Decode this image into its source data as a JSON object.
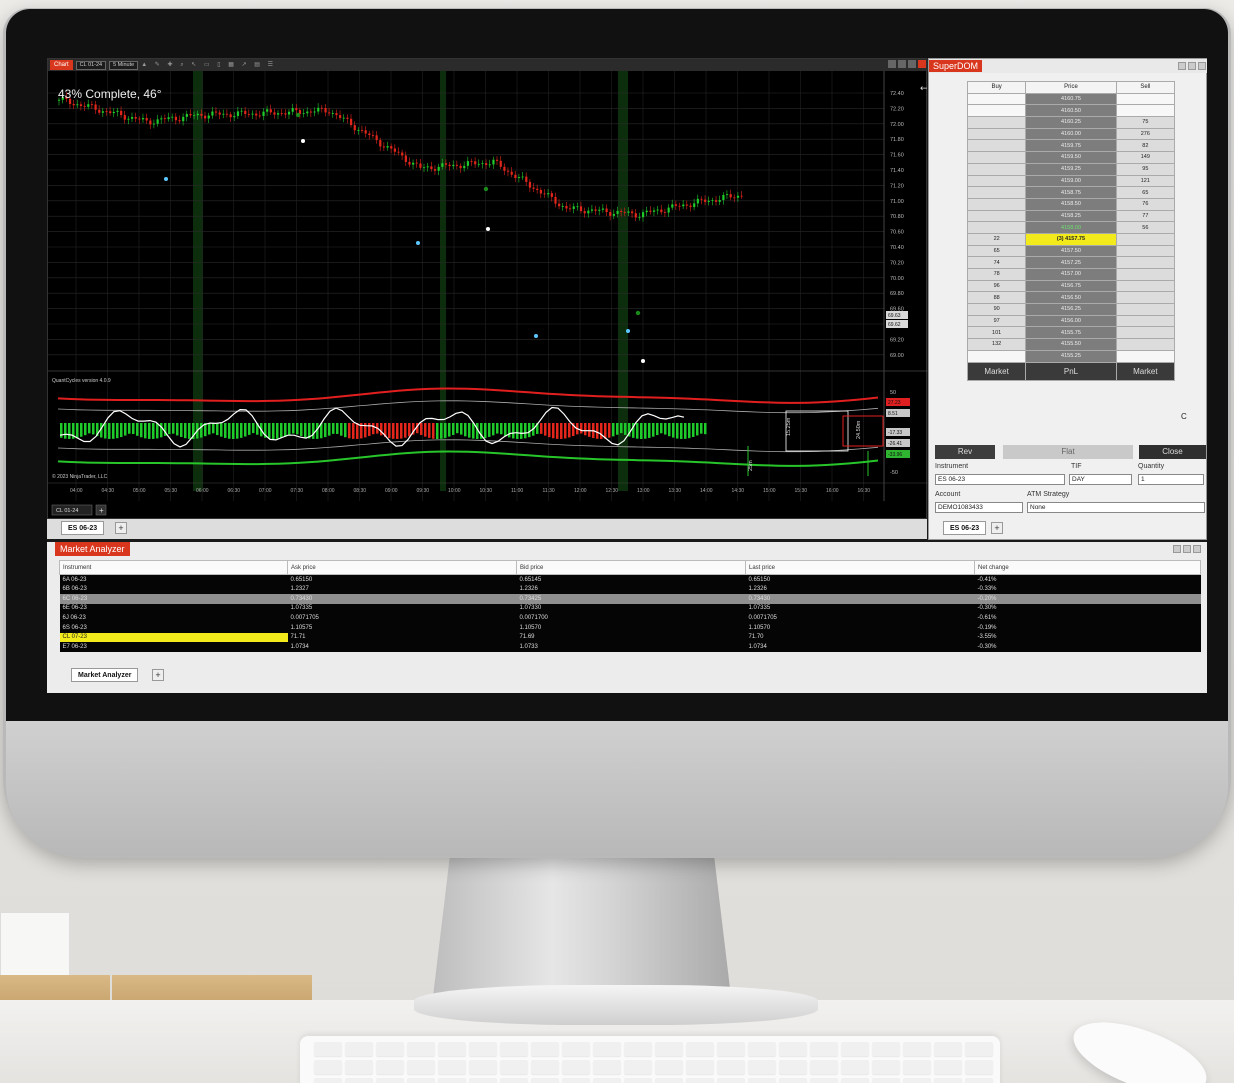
{
  "chart": {
    "title": "Chart",
    "instrument": "CL 01-24",
    "interval": "5 Minute",
    "progress_text": "43% Complete, 46°",
    "indicator_label": "QuantCycles version 4.0.9",
    "copyright": "© 2023 NinjaTrader, LLC",
    "tab_instrument": "CL 01-24",
    "price_ticks": [
      "72.40",
      "72.20",
      "72.00",
      "71.80",
      "71.60",
      "71.40",
      "71.20",
      "71.00",
      "70.80",
      "70.60",
      "70.40",
      "70.20",
      "70.00",
      "69.80",
      "69.60",
      "69.40",
      "69.20",
      "69.00"
    ],
    "price_tags": [
      {
        "label": "69.63",
        "color": "#d9d9d9"
      },
      {
        "label": "69.62",
        "color": "#d9d9d9"
      }
    ],
    "osc_ticks": [
      "50",
      "0",
      "-50"
    ],
    "osc_tags": [
      {
        "label": "27.23",
        "color": "#e02020"
      },
      {
        "label": "8.51",
        "color": "#c7c7c7"
      },
      {
        "label": "-17.33",
        "color": "#c7c7c7"
      },
      {
        "label": "-26.41",
        "color": "#c7c7c7"
      },
      {
        "label": "-33.96",
        "color": "#2fb52f"
      }
    ],
    "time_ticks": [
      "04:00",
      "04:30",
      "05:00",
      "05:30",
      "06:00",
      "06:30",
      "07:00",
      "07:30",
      "08:00",
      "08:30",
      "09:00",
      "09:30",
      "10:00",
      "10:30",
      "11:00",
      "11:30",
      "12:00",
      "12:30",
      "13:00",
      "13:30",
      "14:00",
      "14:30",
      "15:00",
      "15:30",
      "16:00",
      "16:30"
    ],
    "cycle_labels": [
      "15.25m",
      "24.50m",
      "25m"
    ],
    "colors": {
      "up": "#1ecb2a",
      "down": "#e3261b",
      "band_red": "#e21f1f",
      "band_green": "#27c52a"
    }
  },
  "chart_tab": {
    "label": "ES 06-23"
  },
  "superdom": {
    "title": "SuperDOM",
    "headers": [
      "Buy",
      "Price",
      "Sell"
    ],
    "rows": [
      {
        "buy": "",
        "price": "4160.75",
        "sell": ""
      },
      {
        "buy": "",
        "price": "4160.50",
        "sell": ""
      },
      {
        "buy": "",
        "price": "4160.25",
        "sell": "75"
      },
      {
        "buy": "",
        "price": "4160.00",
        "sell": "276"
      },
      {
        "buy": "",
        "price": "4159.75",
        "sell": "82"
      },
      {
        "buy": "",
        "price": "4159.50",
        "sell": "149"
      },
      {
        "buy": "",
        "price": "4159.25",
        "sell": "95"
      },
      {
        "buy": "",
        "price": "4159.00",
        "sell": "121"
      },
      {
        "buy": "",
        "price": "4158.75",
        "sell": "65"
      },
      {
        "buy": "",
        "price": "4158.50",
        "sell": "76"
      },
      {
        "buy": "",
        "price": "4158.25",
        "sell": "77"
      },
      {
        "buy": "",
        "price": "4158.00",
        "sell": "56"
      },
      {
        "buy": "22",
        "price": "(3) 4157.75",
        "sell": ""
      },
      {
        "buy": "65",
        "price": "4157.50",
        "sell": ""
      },
      {
        "buy": "74",
        "price": "4157.25",
        "sell": ""
      },
      {
        "buy": "78",
        "price": "4157.00",
        "sell": ""
      },
      {
        "buy": "96",
        "price": "4156.75",
        "sell": ""
      },
      {
        "buy": "88",
        "price": "4156.50",
        "sell": ""
      },
      {
        "buy": "90",
        "price": "4156.25",
        "sell": ""
      },
      {
        "buy": "97",
        "price": "4156.00",
        "sell": ""
      },
      {
        "buy": "101",
        "price": "4155.75",
        "sell": ""
      },
      {
        "buy": "132",
        "price": "4155.50",
        "sell": ""
      },
      {
        "buy": "",
        "price": "4155.25",
        "sell": ""
      }
    ],
    "footer": {
      "left": "Market",
      "center": "PnL",
      "right": "Market",
      "extra": "C"
    },
    "buttons": {
      "rev": "Rev",
      "flat": "Flat",
      "close": "Close"
    },
    "instrument_label": "Instrument",
    "instrument_value": "ES 06-23",
    "tif_label": "TIF",
    "tif_value": "DAY",
    "quantity_label": "Quantity",
    "quantity_value": "1",
    "account_label": "Account",
    "account_value": "DEMO1083433",
    "atm_label": "ATM Strategy",
    "atm_value": "None",
    "tab_label": "ES 06-23"
  },
  "market_analyzer": {
    "title": "Market Analyzer",
    "columns": [
      "Instrument",
      "Ask price",
      "Bid price",
      "Last price",
      "Net change"
    ],
    "rows": [
      [
        "6A 06-23",
        "0.65150",
        "0.65145",
        "0.65150",
        "-0.41%"
      ],
      [
        "6B 06-23",
        "1.2327",
        "1.2326",
        "1.2326",
        "-0.33%"
      ],
      [
        "6C 06-23",
        "0.73430",
        "0.73425",
        "0.73430",
        "-0.20%"
      ],
      [
        "6E 06-23",
        "1.07335",
        "1.07330",
        "1.07335",
        "-0.30%"
      ],
      [
        "6J 06-23",
        "0.0071705",
        "0.0071700",
        "0.0071705",
        "-0.61%"
      ],
      [
        "6S 06-23",
        "1.10575",
        "1.10570",
        "1.10570",
        "-0.19%"
      ],
      [
        "CL 07-23",
        "71.71",
        "71.69",
        "71.70",
        "-3.55%"
      ],
      [
        "E7 06-23",
        "1.0734",
        "1.0733",
        "1.0734",
        "-0.30%"
      ]
    ],
    "tab_label": "Market Analyzer"
  }
}
